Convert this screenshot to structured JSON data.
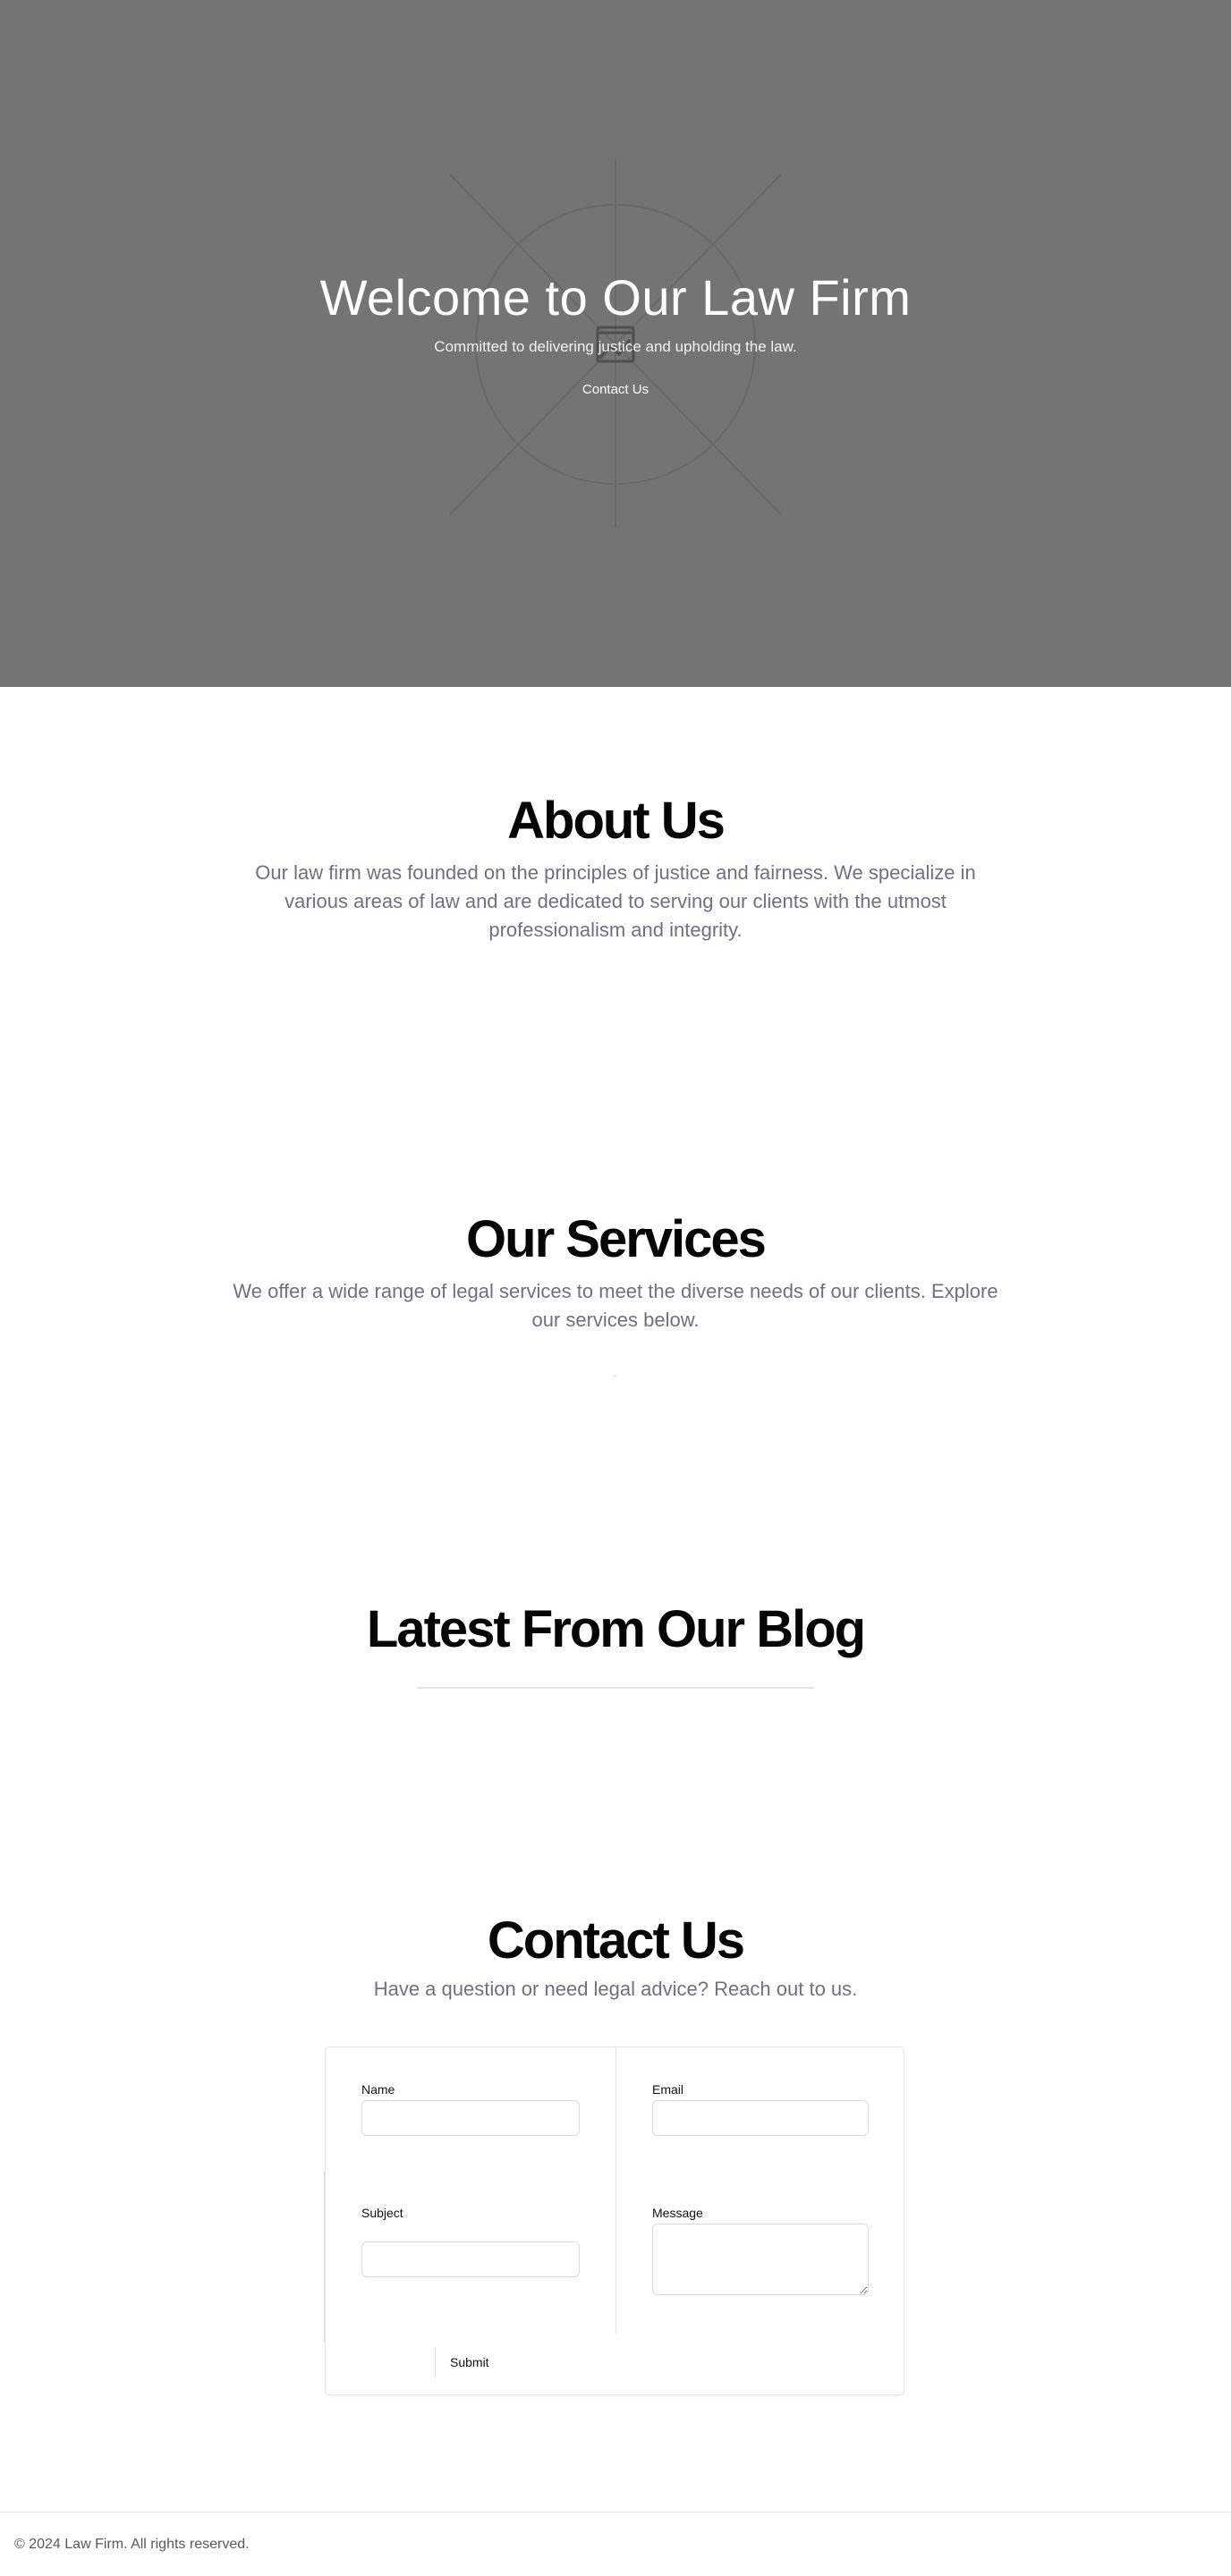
{
  "hero": {
    "title": "Welcome to Our Law Firm",
    "subtitle": "Committed to delivering justice and upholding the law.",
    "cta_label": "Contact Us",
    "background_color": "#747474",
    "placeholder_icon": "image-placeholder-icon"
  },
  "about": {
    "title": "About Us",
    "text": "Our law firm was founded on the principles of justice and fairness. We specialize in various areas of law and are dedicated to serving our clients with the utmost professionalism and integrity."
  },
  "services": {
    "title": "Our Services",
    "text": "We offer a wide range of legal services to meet the diverse needs of our clients. Explore our services below."
  },
  "blog": {
    "title": "Latest From Our Blog"
  },
  "contact": {
    "title": "Contact Us",
    "text": "Have a question or need legal advice? Reach out to us.",
    "form": {
      "name_label": "Name",
      "name_value": "",
      "email_label": "Email",
      "email_value": "",
      "subject_label": "Subject",
      "subject_value": "",
      "message_label": "Message",
      "message_value": "",
      "submit_label": "Submit"
    }
  },
  "footer": {
    "text": "© 2024 Law Firm. All rights reserved."
  },
  "colors": {
    "hero_bg": "#747474",
    "body_text_muted": "#6b7280",
    "heading": "#050505"
  }
}
